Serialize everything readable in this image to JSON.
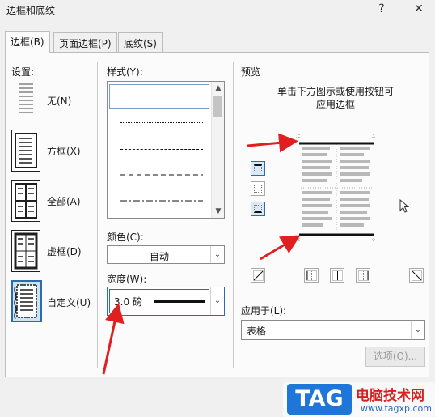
{
  "window": {
    "title": "边框和底纹",
    "help_glyph": "?",
    "close_glyph": "✕"
  },
  "tabs": [
    {
      "label": "边框(B)",
      "active": true
    },
    {
      "label": "页面边框(P)",
      "active": false
    },
    {
      "label": "底纹(S)",
      "active": false
    }
  ],
  "settings": {
    "label": "设置:",
    "items": [
      {
        "label": "无(N)",
        "icon": "border-none-icon"
      },
      {
        "label": "方框(X)",
        "icon": "border-box-icon"
      },
      {
        "label": "全部(A)",
        "icon": "border-all-icon"
      },
      {
        "label": "虚框(D)",
        "icon": "border-grid-icon"
      },
      {
        "label": "自定义(U)",
        "icon": "border-custom-icon",
        "selected": true
      }
    ]
  },
  "style": {
    "label": "样式(Y):",
    "line_styles": [
      "solid",
      "dotted",
      "dashed-short",
      "dashed",
      "dash-dot"
    ]
  },
  "color": {
    "label": "颜色(C):",
    "value": "自动"
  },
  "width": {
    "label": "宽度(W):",
    "value": "3.0 磅"
  },
  "preview": {
    "label": "预览",
    "hint_line1": "单击下方图示或使用按钮可",
    "hint_line2": "应用边框"
  },
  "apply_to": {
    "label": "应用于(L):",
    "value": "表格"
  },
  "options_button": "选项(O)...",
  "watermark": {
    "logo": "TAG",
    "text": "电脑技术网",
    "url": "www.tagxp.com"
  },
  "colors": {
    "accent": "#2b6cb0",
    "annotation_arrow": "#e02020",
    "watermark_blue": "#1d76d8"
  }
}
